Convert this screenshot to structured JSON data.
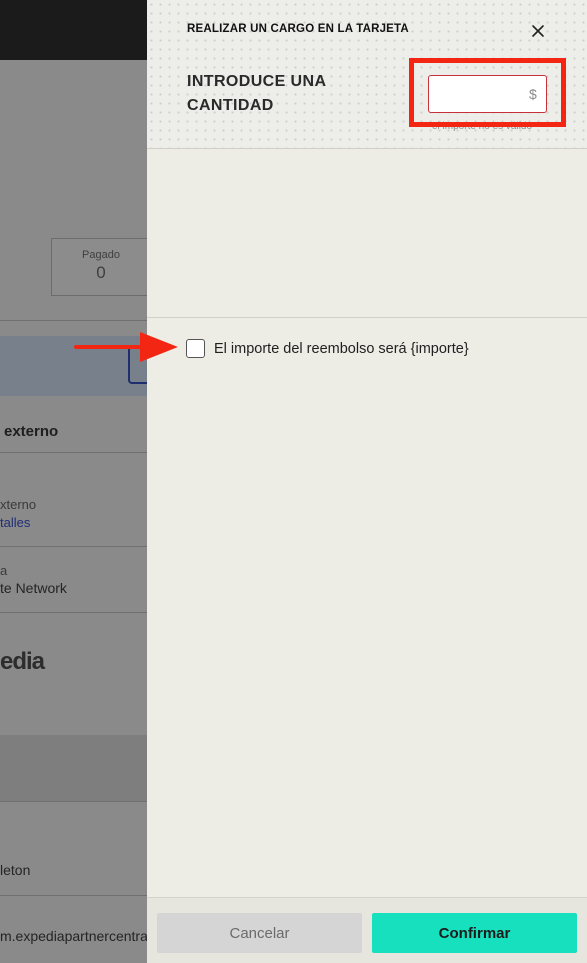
{
  "background": {
    "paid_label": "Pagado",
    "paid_value": "0",
    "section_heading": "externo",
    "row1_label": "xterno",
    "row1_link": "talles",
    "row2_label": "a",
    "row2_value": "te Network",
    "logo_text": "edia",
    "row3_value": "leton",
    "row4_value": "m.expediapartnercentral."
  },
  "drawer": {
    "title": "REALIZAR UN CARGO EN LA TARJETA",
    "close_icon": "close-icon",
    "amount_label": "INTRODUCE UNA CANTIDAD",
    "amount_value": "",
    "currency_symbol": "$",
    "error_message": "el importe no es válido",
    "refund_checkbox_label": "El importe del reembolso será {importe}",
    "refund_checked": false
  },
  "footer": {
    "cancel_label": "Cancelar",
    "confirm_label": "Confirmar"
  },
  "colors": {
    "accent": "#17e0be",
    "error": "#c8303a",
    "annotation": "#f22613"
  }
}
